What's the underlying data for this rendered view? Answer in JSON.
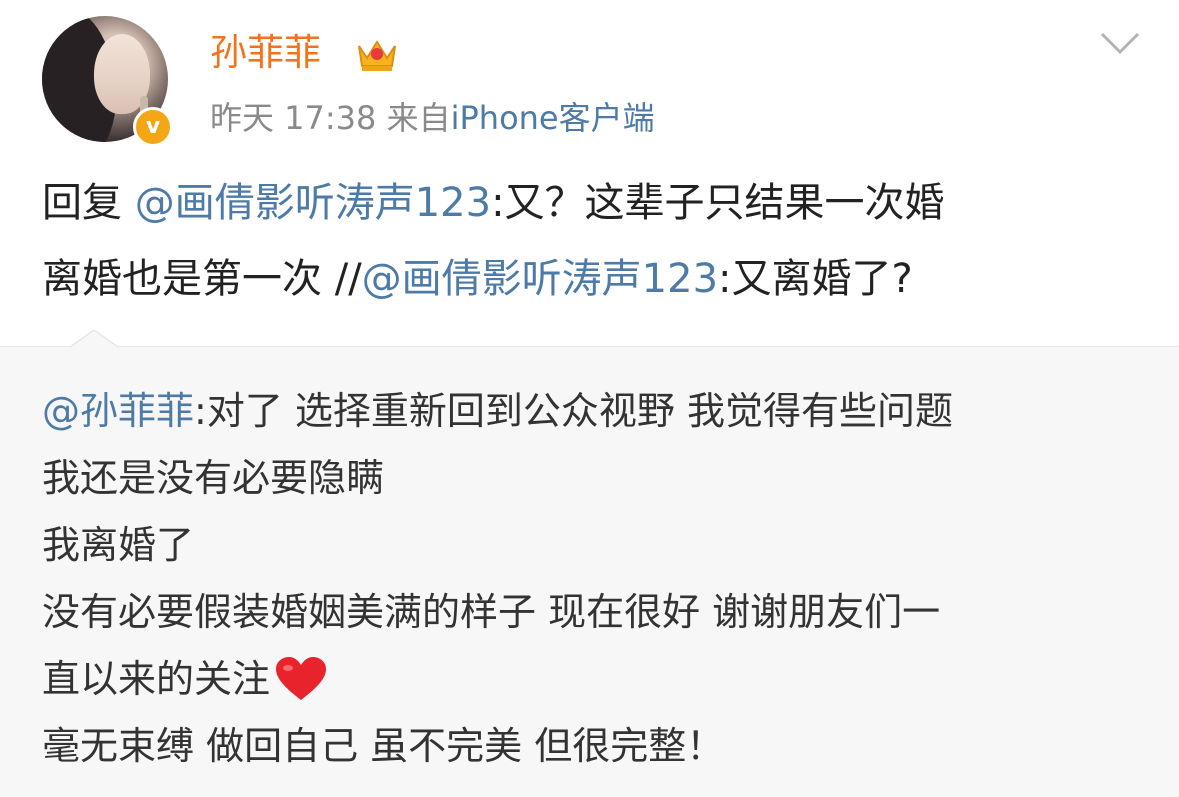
{
  "post": {
    "author": "孙菲菲",
    "time": "昨天 17:38",
    "source_prefix": "来自",
    "source": "iPhone客户端",
    "reply": {
      "line1": {
        "prefix": "回复",
        "mention": "@画倩影听涛声123",
        "text": ":又？这辈子只结果一次婚"
      },
      "line2": {
        "text": "离婚也是第一次",
        "separator": "//",
        "mention": "@画倩影听涛声123",
        "suffix": ":又离婚了?"
      }
    }
  },
  "repost": {
    "mention": "@孙菲菲",
    "lines": [
      ":对了 选择重新回到公众视野 我觉得有些问题",
      "我还是没有必要隐瞒",
      "我离婚了",
      "没有必要假装婚姻美满的样子 现在很好 谢谢朋友们一",
      "直以来的关注",
      "毫无束缚 做回自己 虽不完美 但很完整！"
    ]
  },
  "colors": {
    "username": "#f2731c",
    "link": "#4d7aa7",
    "meta": "#8a8a8a",
    "repost_bg": "#f7f7f7",
    "heart": "#e8232b",
    "badge": "#f3a716"
  },
  "icons": {
    "verified": "verified-badge-icon",
    "crown": "crown-icon",
    "expand": "chevron-down-icon",
    "heart": "heart-emoji-icon"
  }
}
